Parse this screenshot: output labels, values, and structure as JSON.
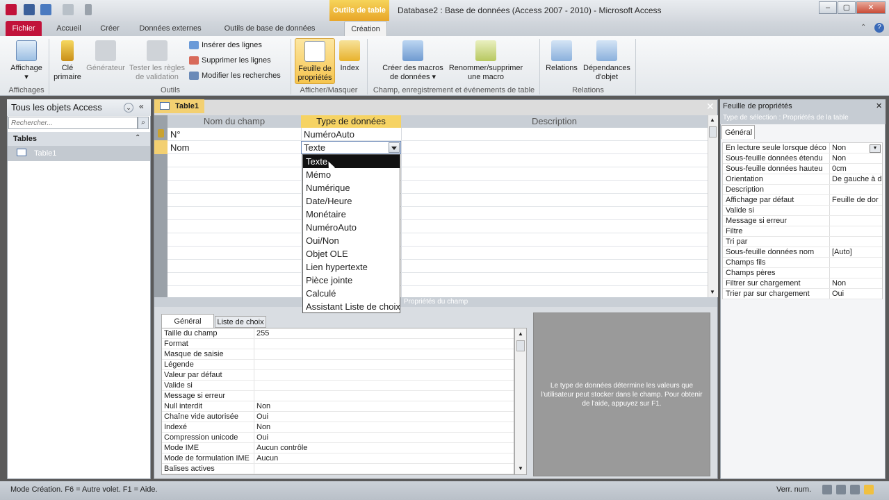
{
  "titlebar": {
    "context_tab": "Outils de table",
    "title": "Database2 : Base de données (Access 2007 - 2010)  -  Microsoft Access",
    "min": "–",
    "max": "▢",
    "close": "✕"
  },
  "tabs": {
    "fichier": "Fichier",
    "accueil": "Accueil",
    "creer": "Créer",
    "donnees_externes": "Données externes",
    "outils_bdd": "Outils de base de données",
    "creation": "Création"
  },
  "ribbon": {
    "affichage": "Affichage",
    "affichage_arrow": "▾",
    "cle": "Clé",
    "primaire": "primaire",
    "generateur": "Générateur",
    "tester1": "Tester les règles",
    "tester2": "de validation",
    "inserer": "Insérer des lignes",
    "supprimer": "Supprimer les lignes",
    "modifier": "Modifier les recherches",
    "feuille1": "Feuille de",
    "feuille2": "propriétés",
    "index": "Index",
    "creer_macros1": "Créer des macros",
    "creer_macros2": "de données ▾",
    "renommer1": "Renommer/supprimer",
    "renommer2": "une macro",
    "relations": "Relations",
    "dependances1": "Dépendances",
    "dependances2": "d'objet",
    "group_affichages": "Affichages",
    "group_outils": "Outils",
    "group_afficher": "Afficher/Masquer",
    "group_champ": "Champ, enregistrement et événements de table",
    "group_relations": "Relations"
  },
  "nav": {
    "title": "Tous les objets Access",
    "search_placeholder": "Rechercher...",
    "section": "Tables",
    "item": "Table1"
  },
  "doc": {
    "tab": "Table1",
    "close": "✕",
    "col_name": "Nom du champ",
    "col_type": "Type de données",
    "col_desc": "Description",
    "rows": [
      {
        "name": "N°",
        "type": "NuméroAuto"
      },
      {
        "name": "Nom",
        "type": "Texte"
      }
    ],
    "field_props_label": "Propriétés du champ"
  },
  "dropdown": {
    "options": [
      "Texte",
      "Mémo",
      "Numérique",
      "Date/Heure",
      "Monétaire",
      "NuméroAuto",
      "Oui/Non",
      "Objet OLE",
      "Lien hypertexte",
      "Pièce jointe",
      "Calculé",
      "Assistant Liste de choix"
    ],
    "selected_index": 0
  },
  "field_props": {
    "tab_general": "Général",
    "tab_liste": "Liste de choix",
    "rows": [
      {
        "n": "Taille du champ",
        "v": "255"
      },
      {
        "n": "Format",
        "v": ""
      },
      {
        "n": "Masque de saisie",
        "v": ""
      },
      {
        "n": "Légende",
        "v": ""
      },
      {
        "n": "Valeur par défaut",
        "v": ""
      },
      {
        "n": "Valide si",
        "v": ""
      },
      {
        "n": "Message si erreur",
        "v": ""
      },
      {
        "n": "Null interdit",
        "v": "Non"
      },
      {
        "n": "Chaîne vide autorisée",
        "v": "Oui"
      },
      {
        "n": "Indexé",
        "v": "Non"
      },
      {
        "n": "Compression unicode",
        "v": "Oui"
      },
      {
        "n": "Mode IME",
        "v": "Aucun contrôle"
      },
      {
        "n": "Mode de formulation IME",
        "v": "Aucun"
      },
      {
        "n": "Balises actives",
        "v": ""
      }
    ],
    "help": "Le type de données détermine les valeurs que l'utilisateur peut stocker dans le champ. Pour obtenir de l'aide, appuyez sur F1."
  },
  "property_sheet": {
    "title": "Feuille de propriétés",
    "selection": "Type de sélection :  Propriétés de la table",
    "tab": "Général",
    "rows": [
      {
        "n": "En lecture seule lorsque déco",
        "v": "Non"
      },
      {
        "n": "Sous-feuille données étendu",
        "v": "Non"
      },
      {
        "n": "Sous-feuille données hauteu",
        "v": "0cm"
      },
      {
        "n": "Orientation",
        "v": "De gauche à d"
      },
      {
        "n": "Description",
        "v": ""
      },
      {
        "n": "Affichage par défaut",
        "v": "Feuille de dor"
      },
      {
        "n": "Valide si",
        "v": ""
      },
      {
        "n": "Message si erreur",
        "v": ""
      },
      {
        "n": "Filtre",
        "v": ""
      },
      {
        "n": "Tri par",
        "v": ""
      },
      {
        "n": "Sous-feuille données nom",
        "v": "[Auto]"
      },
      {
        "n": "Champs fils",
        "v": ""
      },
      {
        "n": "Champs pères",
        "v": ""
      },
      {
        "n": "Filtrer sur chargement",
        "v": "Non"
      },
      {
        "n": "Trier par sur chargement",
        "v": "Oui"
      }
    ]
  },
  "status": {
    "left": "Mode Création.  F6 = Autre volet.  F1 = Aide.",
    "right": "Verr. num."
  }
}
